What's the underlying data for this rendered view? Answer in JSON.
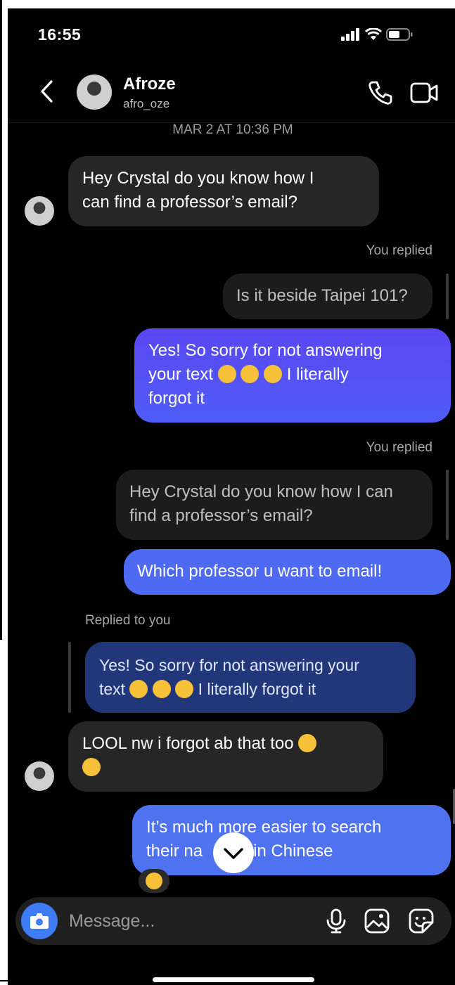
{
  "status": {
    "time": "16:55"
  },
  "header": {
    "name": "Afroze",
    "handle": "afro_oze"
  },
  "thread": {
    "date": "MAR 2 AT 10:36 PM",
    "msg1": {
      "line1": "Hey Crystal do you know how I",
      "line2": "can find a professor’s email?"
    },
    "reply_label_1": "You replied",
    "quote1": "Is it beside Taipei 101?",
    "msg2": {
      "line1": "Yes! So sorry for not answering",
      "line2a": "your text",
      "line2b": "I literally",
      "line3": "forgot it"
    },
    "reply_label_2": "You replied",
    "quote2": {
      "line1": "Hey Crystal do you know how I can",
      "line2": "find a professor’s email?"
    },
    "msg3": "Which professor u want to email!",
    "reply_label_3": "Replied to you",
    "quote3": {
      "line1": "Yes! So sorry for not answering your",
      "line2a": "text",
      "line2b": "I literally forgot it"
    },
    "msg4": {
      "line1": "LOOL nw i forgot ab that too"
    },
    "msg5": {
      "line1": "It’s much more easier to search",
      "line2a": "their na",
      "line2b": "in Chinese"
    }
  },
  "composer": {
    "placeholder": "Message..."
  },
  "colors": {
    "sent": "#5a47f2",
    "sent_alt": "#4f6bf2",
    "received": "#262626",
    "camera": "#3d7cf5"
  }
}
